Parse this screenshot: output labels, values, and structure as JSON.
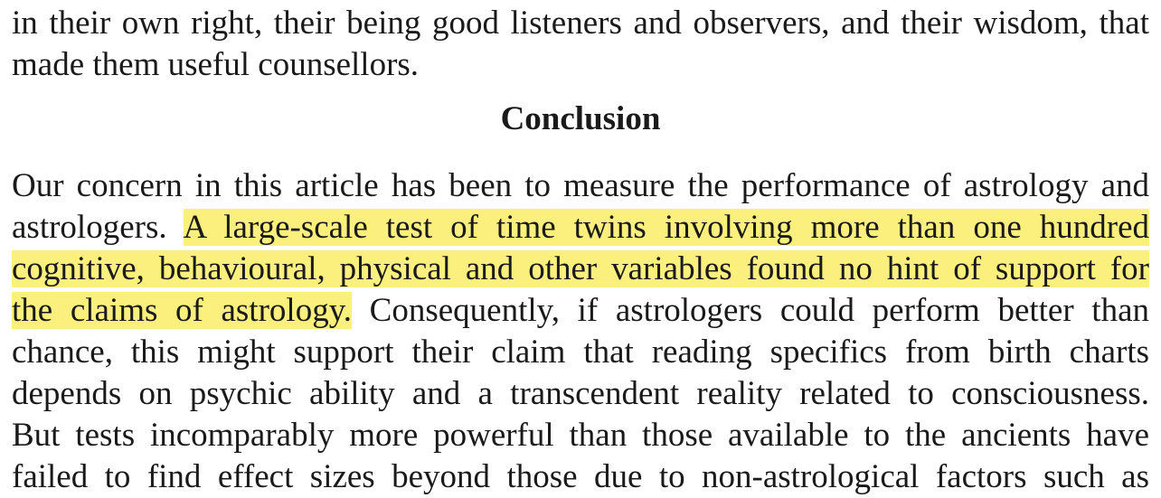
{
  "previous_paragraph": {
    "cut_line": "in their own right, their being good listeners and observers, and their wisdom, that",
    "last_line": "made them useful counsellors."
  },
  "section": {
    "heading": "Conclusion"
  },
  "paragraph": {
    "line1": "Our concern in this article has been to measure the performance of astrology and",
    "line2_plain": "astrologers. ",
    "line2_highlight": "A large-scale test of time twins involving more than one hundred",
    "line3_highlight": "cognitive, behavioural, physical and other variables found no hint of support for",
    "line4_highlight": "the claims of astrology.",
    "line4_plain": " Consequently, if astrologers could perform better than",
    "line5": "chance, this might support their claim that reading specifics from birth charts",
    "line6": "depends on psychic ability and a transcendent reality related to consciousness.",
    "line7": "But tests incomparably more powerful than those available to the ancients have",
    "line8": "failed to find effect sizes beyond those due to non-astrological factors such as"
  },
  "colors": {
    "highlight": "#fbf07e",
    "text": "#1a1a1a"
  }
}
